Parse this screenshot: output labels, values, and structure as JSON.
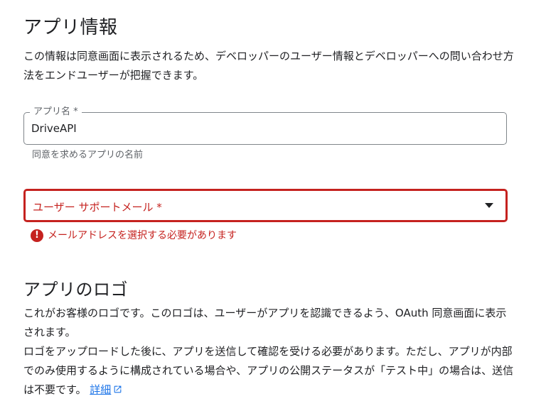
{
  "app_info": {
    "title": "アプリ情報",
    "description": "この情報は同意画面に表示されるため、デベロッパーのユーザー情報とデベロッパーへの問い合わせ方法をエンドユーザーが把握できます。"
  },
  "app_name_field": {
    "label": "アプリ名 *",
    "value": "DriveAPI",
    "hint": "同意を求めるアプリの名前"
  },
  "support_email_field": {
    "label": "ユーザー サポートメール *",
    "error": "メールアドレスを選択する必要があります",
    "error_icon": "!",
    "state": "error"
  },
  "logo_section": {
    "title": "アプリのロゴ",
    "description_1": "これがお客様のロゴです。このロゴは、ユーザーがアプリを認識できるよう、OAuth 同意画面に表示されます。",
    "description_2": "ロゴをアップロードした後に、アプリを送信して確認を受ける必要があります。ただし、アプリが内部でのみ使用するように構成されている場合や、アプリの公開ステータスが「テスト中」の場合は、送信は不要です。",
    "link_label": "詳細"
  },
  "colors": {
    "error": "#c5221f",
    "link": "#1a73e8",
    "outline": "#80868b"
  },
  "icons": {
    "dropdown": "dropdown-arrow-icon",
    "error": "error-icon",
    "external_link": "open-in-new-icon"
  }
}
